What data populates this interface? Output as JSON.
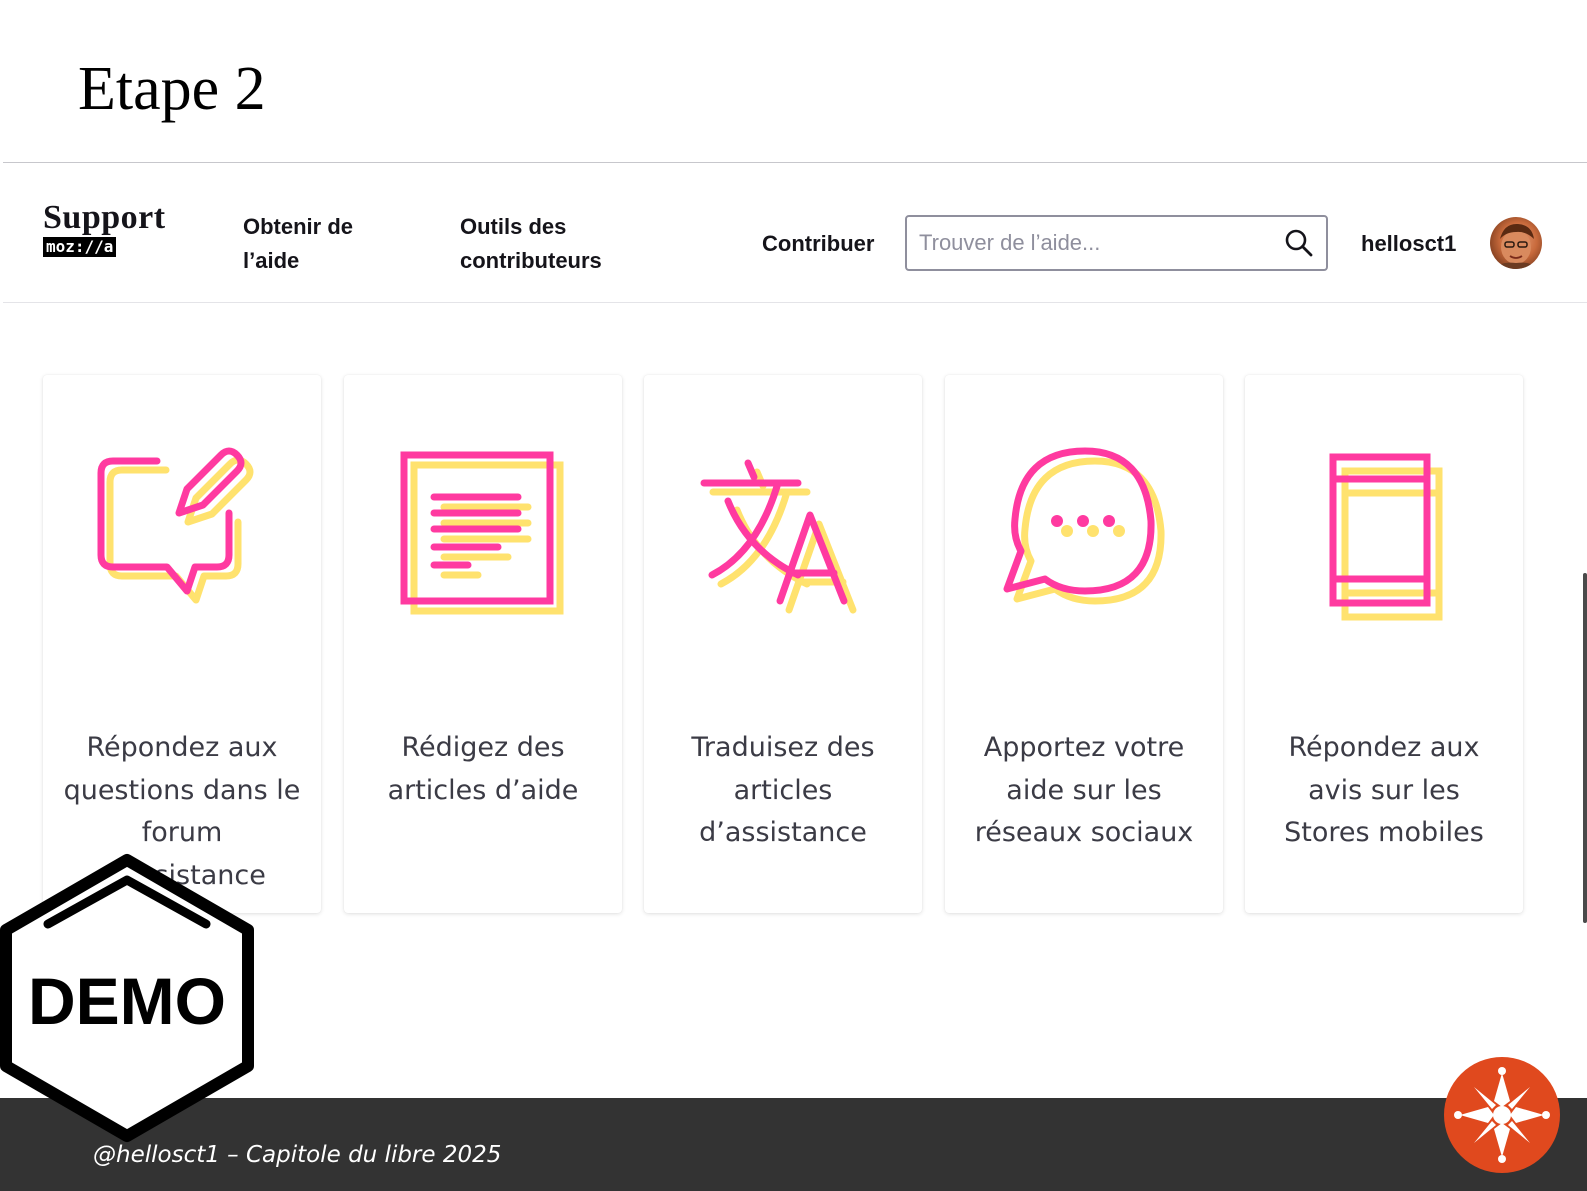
{
  "slide": {
    "title": "Etape 2",
    "footer": "@hellosct1 – Capitole du libre 2025",
    "badge_label": "DEMO"
  },
  "header": {
    "logo_support": "Support",
    "logo_mozilla": "moz://a",
    "nav": {
      "obtenir": "Obtenir de l’aide",
      "outils": "Outils des contributeurs",
      "contribuer": "Contribuer"
    },
    "search_placeholder": "Trouver de l’aide...",
    "username": "hellosct1"
  },
  "cards": [
    {
      "label": "Répondez aux questions dans le forum d’assistance",
      "icon": "edit-chat-icon"
    },
    {
      "label": "Rédigez des articles d’aide",
      "icon": "document-icon"
    },
    {
      "label": "Traduisez des articles d’assistance",
      "icon": "translate-icon"
    },
    {
      "label": "Apportez votre aide sur les réseaux sociaux",
      "icon": "speech-bubble-icon"
    },
    {
      "label": "Répondez aux avis sur les Stores mobiles",
      "icon": "mobile-phone-icon"
    }
  ],
  "colors": {
    "icon_primary": "#ff3aa0",
    "icon_shadow": "#ffe26e",
    "footer_bar": "#333333",
    "occitan_logo": "#e0491e"
  }
}
